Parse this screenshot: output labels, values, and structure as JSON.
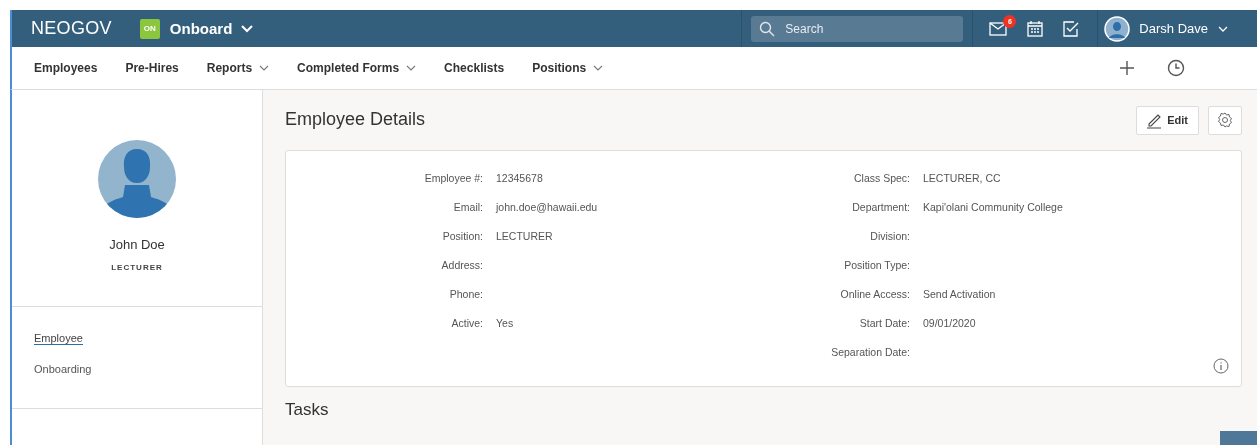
{
  "header": {
    "brand": "NEOGOV",
    "app_badge": "ON",
    "app_name": "Onboard",
    "search": {
      "placeholder": "Search"
    },
    "mail_badge": "6",
    "user_name": "Darsh Dave"
  },
  "nav": [
    {
      "label": "Employees",
      "has_menu": false
    },
    {
      "label": "Pre-Hires",
      "has_menu": false
    },
    {
      "label": "Reports",
      "has_menu": true
    },
    {
      "label": "Completed Forms",
      "has_menu": true
    },
    {
      "label": "Checklists",
      "has_menu": false
    },
    {
      "label": "Positions",
      "has_menu": true
    }
  ],
  "profile": {
    "name": "John Doe",
    "title": "LECTURER"
  },
  "sidebar": {
    "items": [
      {
        "label": "Employee",
        "selected": true
      },
      {
        "label": "Onboarding",
        "selected": false
      }
    ]
  },
  "page_title": "Employee Details",
  "edit_button": "Edit",
  "details": {
    "left": [
      {
        "label": "Employee #:",
        "value": "12345678"
      },
      {
        "label": "Email:",
        "value": "john.doe@hawaii.edu"
      },
      {
        "label": "Position:",
        "value": "LECTURER"
      },
      {
        "label": "Address:"
      },
      {
        "label": "Phone:"
      },
      {
        "label": "Active:",
        "value": "Yes"
      }
    ],
    "right": [
      {
        "label": "Class Spec:",
        "value": "LECTURER, CC"
      },
      {
        "label": "Department:",
        "value": "Kapi'olani Community College"
      },
      {
        "label": "Division:"
      },
      {
        "label": "Position Type:"
      },
      {
        "label": "Online Access:",
        "value": "Send Activation"
      },
      {
        "label": "Start Date:",
        "value": "09/01/2020"
      },
      {
        "label": "Separation Date:"
      }
    ]
  },
  "tasks_title": "Tasks"
}
